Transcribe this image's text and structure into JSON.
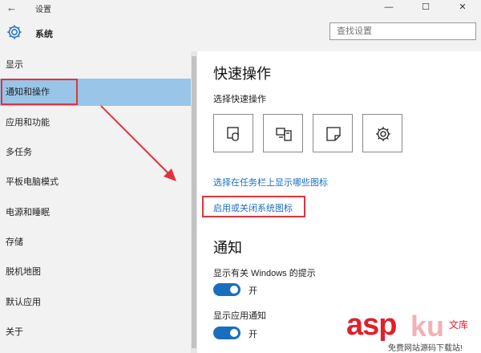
{
  "window": {
    "back_glyph": "←",
    "title": "设置",
    "minimize_glyph": "—",
    "maximize_glyph": "☐",
    "close_glyph": "✕"
  },
  "header": {
    "section_title": "系统",
    "search_placeholder": "查找设置"
  },
  "sidebar": {
    "items": [
      {
        "label": "显示"
      },
      {
        "label": "通知和操作"
      },
      {
        "label": "应用和功能"
      },
      {
        "label": "多任务"
      },
      {
        "label": "平板电脑模式"
      },
      {
        "label": "电源和睡眠"
      },
      {
        "label": "存储"
      },
      {
        "label": "脱机地图"
      },
      {
        "label": "默认应用"
      },
      {
        "label": "关于"
      }
    ],
    "active_index": 1
  },
  "main": {
    "quick_actions_heading": "快速操作",
    "quick_actions_sub": "选择快速操作",
    "tiles": [
      {
        "icon": "tablet-mode-icon"
      },
      {
        "icon": "project-display-icon"
      },
      {
        "icon": "note-icon"
      },
      {
        "icon": "settings-gear-icon"
      }
    ],
    "link_taskbar_icons": "选择在任务栏上显示哪些图标",
    "link_system_icons": "启用或关闭系统图标",
    "notifications_heading": "通知",
    "tips_label": "显示有关 Windows 的提示",
    "tips_state": "开",
    "app_notif_label": "显示应用通知",
    "app_notif_state": "开"
  },
  "watermark": {
    "brand": "asp",
    "brand_ku": "ku",
    "brand_tail": "文库",
    "tagline": "免费网站源码下载站!"
  },
  "colors": {
    "accent": "#1a6ec0",
    "highlight_red": "#e0333d",
    "active_nav": "#98c5e8"
  }
}
